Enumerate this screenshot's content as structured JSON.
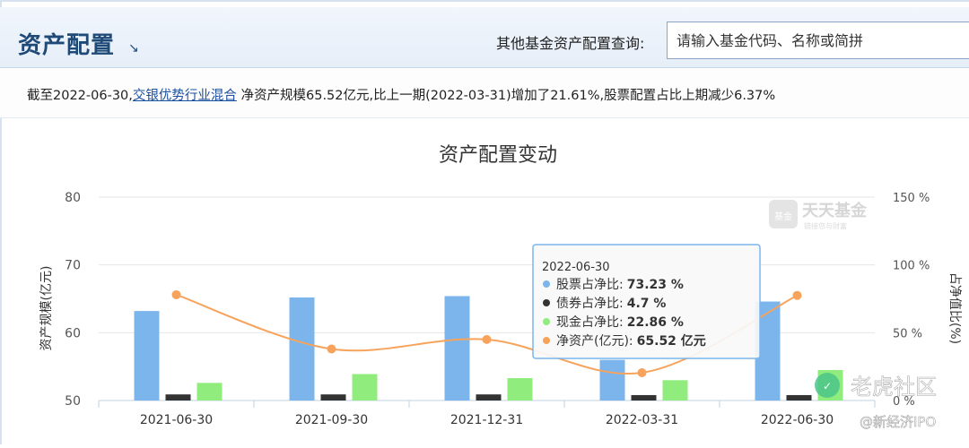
{
  "header": {
    "title": "资产配置",
    "title_arrow": "↘",
    "query_label": "其他基金资产配置查询:",
    "query_placeholder": "请输入基金代码、名称或简拼"
  },
  "summary": {
    "prefix": "截至2022-06-30,",
    "fund_link": "交银优势行业混合",
    "suffix": " 净资产规模65.52亿元,比上一期(2022-03-31)增加了21.61%,股票配置占比上期减少6.37%"
  },
  "watermarks": {
    "logo_main": "天天基金",
    "logo_sub": "链接您与财富",
    "logo_badge": "基金",
    "bottom_main": "老虎社区",
    "bottom_sub": "@新经济IPO"
  },
  "chart_data": {
    "type": "bar",
    "title": "资产配置变动",
    "categories": [
      "2021-06-30",
      "2021-09-30",
      "2021-12-31",
      "2022-03-31",
      "2022-06-30"
    ],
    "left_axis": {
      "label": "资产规模(亿元)",
      "ticks": [
        "50",
        "60",
        "70",
        "80"
      ],
      "ylim": [
        50,
        80
      ]
    },
    "right_axis": {
      "label": "占净值比(%)",
      "ticks": [
        "0 %",
        "50 %",
        "100 %",
        "150 %"
      ],
      "ylim": [
        0,
        150
      ]
    },
    "series": [
      {
        "name": "股票占净比",
        "axis": "left",
        "color": "#7cb5ec",
        "values": [
          63.2,
          65.2,
          65.4,
          56.0,
          64.6
        ]
      },
      {
        "name": "债券占净比",
        "axis": "left",
        "color": "#333333",
        "values": [
          50.9,
          50.9,
          50.9,
          50.8,
          50.8
        ]
      },
      {
        "name": "现金占净比",
        "axis": "left",
        "color": "#90ed7d",
        "values": [
          52.6,
          53.9,
          53.3,
          53.0,
          54.5
        ]
      },
      {
        "name": "净资产",
        "axis": "left",
        "type": "line",
        "color": "#f7a35c",
        "values": [
          65.6,
          57.6,
          59.0,
          54.1,
          65.5
        ]
      }
    ],
    "tooltip": {
      "title": "2022-06-30",
      "rows": [
        {
          "name": "股票占净比:",
          "value": "73.23 %",
          "color": "#7cb5ec"
        },
        {
          "name": "债券占净比:",
          "value": "4.7 %",
          "color": "#333333"
        },
        {
          "name": "现金占净比:",
          "value": "22.86 %",
          "color": "#90ed7d"
        },
        {
          "name": "净资产(亿元):",
          "value": "65.52 亿元",
          "color": "#f7a35c"
        }
      ]
    },
    "grid": true
  }
}
